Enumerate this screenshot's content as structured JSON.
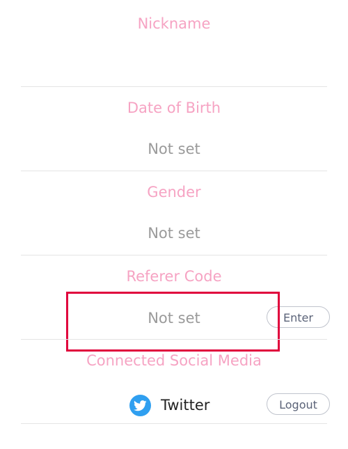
{
  "nickname": {
    "title": "Nickname",
    "value": ""
  },
  "date_of_birth": {
    "title": "Date of Birth",
    "value": "Not set"
  },
  "gender": {
    "title": "Gender",
    "value": "Not set"
  },
  "referer_code": {
    "title": "Referer Code",
    "value": "Not set",
    "button_label": "Enter"
  },
  "social": {
    "title": "Connected Social Media",
    "items": [
      {
        "icon": "twitter-icon",
        "label": "Twitter",
        "button_label": "Logout"
      }
    ]
  },
  "colors": {
    "title": "#f6a3c3",
    "value_placeholder": "#9a9a9a",
    "twitter": "#2f9ff0",
    "highlight": "#e0003c"
  }
}
